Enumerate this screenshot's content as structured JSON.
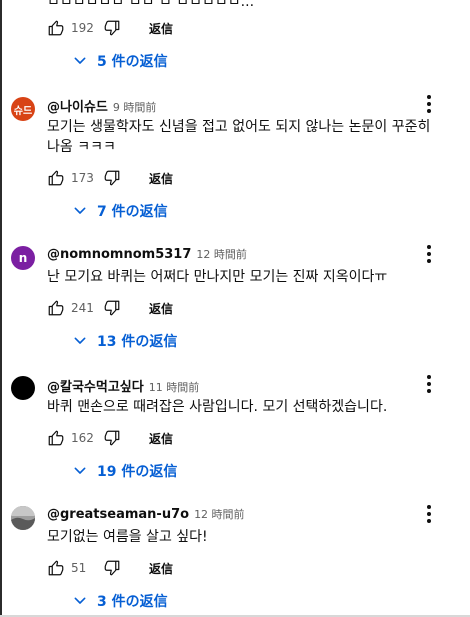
{
  "clipped_text": "ㅁㅁㅁㅁㅁㅁ ㅁㅁ ㅁ ㅁㅁㅁㅁㅁ...",
  "reply_label": "返信",
  "comments": [
    {
      "avatar_text": "",
      "avatar_color": "",
      "author": "",
      "time": "",
      "text": "",
      "likes": "192",
      "replies": "5 件の返信"
    },
    {
      "avatar_text": "슈드",
      "avatar_color": "#d84315",
      "author": "@나이슈드",
      "time": "9 時間前",
      "text": "모기는 생물학자도 신념을 접고 없어도 되지 않나는 논문이 꾸준히 나옴 ㅋㅋㅋ",
      "likes": "173",
      "replies": "7 件の返信"
    },
    {
      "avatar_text": "n",
      "avatar_color": "#7b1fa2",
      "author": "@nomnomnom5317",
      "time": "12 時間前",
      "text": "난 모기요 바퀴는 어쩌다 만나지만 모기는 진짜 지옥이다ㅠ",
      "likes": "241",
      "replies": "13 件の返信"
    },
    {
      "avatar_text": "",
      "avatar_color": "#000000",
      "author": "@칼국수먹고싶다",
      "time": "11 時間前",
      "text": "바퀴 맨손으로 때려잡은 사람입니다. 모기 선택하겠습니다.",
      "likes": "162",
      "replies": "19 件の返信"
    },
    {
      "avatar_text": "",
      "avatar_color": "#8a8a8a",
      "author": "@greatseaman-u7o",
      "time": "12 時間前",
      "text": "모기없는 여름을 살고 싶다!",
      "likes": "51",
      "replies": "3 件の返信"
    }
  ],
  "icons": {
    "like": "thumbs-up-icon",
    "dislike": "thumbs-down-icon",
    "more": "more-vert-icon",
    "expand": "chevron-down-icon"
  }
}
